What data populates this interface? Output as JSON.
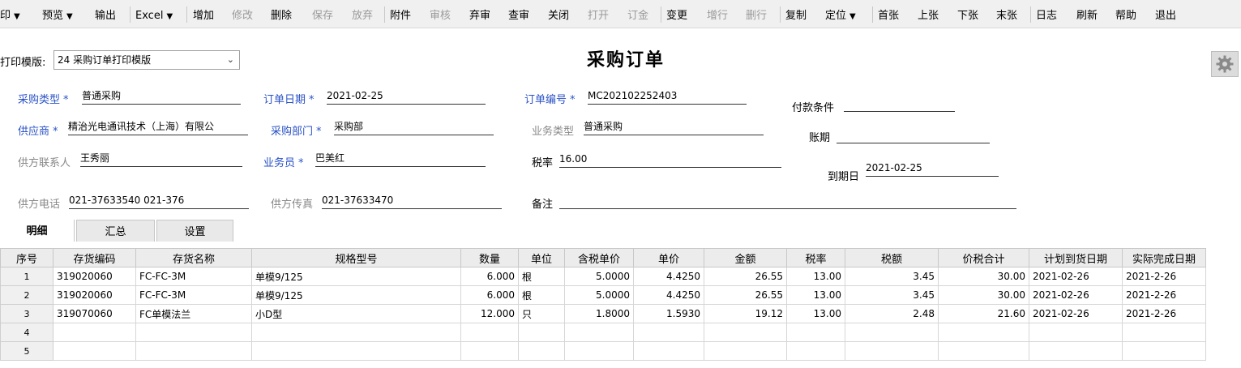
{
  "toolbar": [
    {
      "label": "印",
      "dropdown": true,
      "enabled": true
    },
    {
      "label": "预览",
      "dropdown": true,
      "enabled": true
    },
    {
      "label": "输出",
      "dropdown": false,
      "enabled": true
    },
    {
      "label": "Excel",
      "dropdown": true,
      "enabled": true
    },
    {
      "label": "增加",
      "dropdown": false,
      "enabled": true
    },
    {
      "label": "修改",
      "dropdown": false,
      "enabled": false
    },
    {
      "label": "删除",
      "dropdown": false,
      "enabled": true
    },
    {
      "label": "保存",
      "dropdown": false,
      "enabled": false
    },
    {
      "label": "放弃",
      "dropdown": false,
      "enabled": false
    },
    {
      "label": "附件",
      "dropdown": false,
      "enabled": true
    },
    {
      "label": "审核",
      "dropdown": false,
      "enabled": false
    },
    {
      "label": "弃审",
      "dropdown": false,
      "enabled": true
    },
    {
      "label": "查审",
      "dropdown": false,
      "enabled": true
    },
    {
      "label": "关闭",
      "dropdown": false,
      "enabled": true
    },
    {
      "label": "打开",
      "dropdown": false,
      "enabled": false
    },
    {
      "label": "订金",
      "dropdown": false,
      "enabled": false
    },
    {
      "label": "变更",
      "dropdown": false,
      "enabled": true
    },
    {
      "label": "增行",
      "dropdown": false,
      "enabled": false
    },
    {
      "label": "删行",
      "dropdown": false,
      "enabled": false
    },
    {
      "label": "复制",
      "dropdown": false,
      "enabled": true
    },
    {
      "label": "定位",
      "dropdown": true,
      "enabled": true
    },
    {
      "label": "首张",
      "dropdown": false,
      "enabled": true
    },
    {
      "label": "上张",
      "dropdown": false,
      "enabled": true
    },
    {
      "label": "下张",
      "dropdown": false,
      "enabled": true
    },
    {
      "label": "末张",
      "dropdown": false,
      "enabled": true
    },
    {
      "label": "日志",
      "dropdown": false,
      "enabled": true
    },
    {
      "label": "刷新",
      "dropdown": false,
      "enabled": true
    },
    {
      "label": "帮助",
      "dropdown": false,
      "enabled": true
    },
    {
      "label": "退出",
      "dropdown": false,
      "enabled": true
    }
  ],
  "print_template": {
    "label": "打印模版:",
    "value": "24 采购订单打印模版"
  },
  "title": "采购订单",
  "form": {
    "purchase_type": {
      "label": "采购类型",
      "req": "*",
      "value": "普通采购"
    },
    "order_date": {
      "label": "订单日期",
      "req": "*",
      "value": "2021-02-25"
    },
    "order_no": {
      "label": "订单编号",
      "req": "*",
      "value": "MC202102252403"
    },
    "payment_terms": {
      "label": "付款条件",
      "value": ""
    },
    "supplier": {
      "label": "供应商",
      "req": "*",
      "value": "精治光电通讯技术（上海）有限公"
    },
    "purchase_dept": {
      "label": "采购部门",
      "req": "*",
      "value": "采购部"
    },
    "business_type": {
      "label": "业务类型",
      "value": "普通采购"
    },
    "account_period": {
      "label": "账期",
      "value": ""
    },
    "supplier_contact": {
      "label": "供方联系人",
      "value": "王秀丽"
    },
    "salesperson": {
      "label": "业务员",
      "req": "*",
      "value": "巴美红"
    },
    "tax_rate": {
      "label": "税率",
      "value": "16.00"
    },
    "due_date": {
      "label": "到期日",
      "value": "2021-02-25"
    },
    "supplier_phone": {
      "label": "供方电话",
      "value": "021-37633540 021-376"
    },
    "supplier_fax": {
      "label": "供方传真",
      "value": "021-37633470"
    },
    "remarks": {
      "label": "备注",
      "value": ""
    }
  },
  "tabs": [
    "明细",
    "汇总",
    "设置"
  ],
  "grid": {
    "columns": [
      "序号",
      "存货编码",
      "存货名称",
      "规格型号",
      "数量",
      "单位",
      "含税单价",
      "单价",
      "金额",
      "税率",
      "税额",
      "价税合计",
      "计划到货日期",
      "实际完成日期"
    ],
    "rows": [
      [
        "1",
        "319020060",
        "FC-FC-3M",
        "单模9/125",
        "6.000",
        "根",
        "5.0000",
        "4.4250",
        "26.55",
        "13.00",
        "3.45",
        "30.00",
        "2021-02-26",
        "2021-2-26"
      ],
      [
        "2",
        "319020060",
        "FC-FC-3M",
        "单模9/125",
        "6.000",
        "根",
        "5.0000",
        "4.4250",
        "26.55",
        "13.00",
        "3.45",
        "30.00",
        "2021-02-26",
        "2021-2-26"
      ],
      [
        "3",
        "319070060",
        "FC单模法兰",
        "小D型",
        "12.000",
        "只",
        "1.8000",
        "1.5930",
        "19.12",
        "13.00",
        "2.48",
        "21.60",
        "2021-02-26",
        "2021-2-26"
      ],
      [
        "4",
        "",
        "",
        "",
        "",
        "",
        "",
        "",
        "",
        "",
        "",
        "",
        "",
        ""
      ],
      [
        "5",
        "",
        "",
        "",
        "",
        "",
        "",
        "",
        "",
        "",
        "",
        "",
        "",
        ""
      ]
    ]
  }
}
